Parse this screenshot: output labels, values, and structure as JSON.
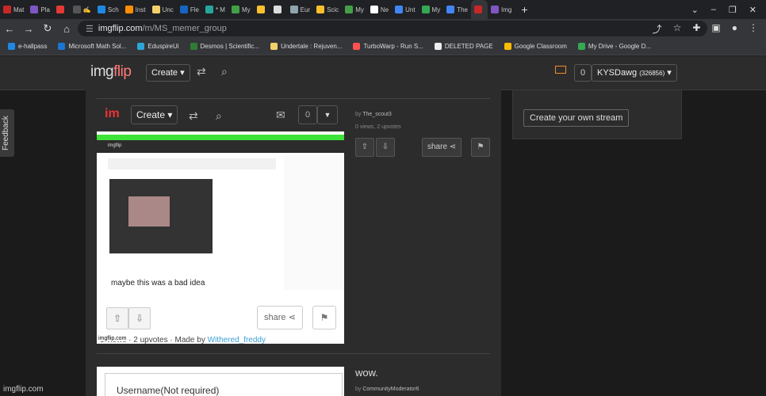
{
  "tabs": [
    {
      "label": "Mat",
      "color": "#c62828"
    },
    {
      "label": "Pla",
      "color": "#7e57c2"
    },
    {
      "label": "",
      "color": "#e53935"
    },
    {
      "label": "✍",
      "color": "#555555"
    },
    {
      "label": "Sch",
      "color": "#1e88e5"
    },
    {
      "label": "Inst",
      "color": "#ff8f00"
    },
    {
      "label": "Unc",
      "color": "#f2d16b"
    },
    {
      "label": "Fle",
      "color": "#1565c0"
    },
    {
      "label": "* M",
      "color": "#26a69a"
    },
    {
      "label": "My",
      "color": "#43a047"
    },
    {
      "label": "",
      "color": "#fbc02d"
    },
    {
      "label": "",
      "color": "#dddddd"
    },
    {
      "label": "Eur",
      "color": "#90a4ae"
    },
    {
      "label": "Scic",
      "color": "#fbc02d"
    },
    {
      "label": "My",
      "color": "#43a047"
    },
    {
      "label": "Ne",
      "color": "#ffffff"
    },
    {
      "label": "Unt",
      "color": "#4285f4"
    },
    {
      "label": "My",
      "color": "#34a853"
    },
    {
      "label": "The",
      "color": "#4285f4"
    },
    {
      "label": "",
      "color": "#c62828"
    },
    {
      "label": "Img",
      "color": "#7e57c2"
    }
  ],
  "url": {
    "host": "imgflip.com",
    "path": "/m/MS_memer_group"
  },
  "bookmarks": [
    {
      "label": "e-hallpass",
      "color": "#1e88e5"
    },
    {
      "label": "Microsoft Math Sol...",
      "color": "#1976d2"
    },
    {
      "label": "EduspireUi",
      "color": "#2aa7d8"
    },
    {
      "label": "Desmos | Scientific...",
      "color": "#2e7d32"
    },
    {
      "label": "Undertale : Rejuven...",
      "color": "#f2d16b"
    },
    {
      "label": "TurboWarp - Run S...",
      "color": "#ff5252"
    },
    {
      "label": "DELETED PAGE",
      "color": "#eeeeee"
    },
    {
      "label": "Google Classroom",
      "color": "#fbbc04"
    },
    {
      "label": "My Drive - Google D...",
      "color": "#34a853"
    }
  ],
  "site": {
    "logo_a": "img",
    "logo_b": "flip",
    "create_label": "Create",
    "notif_count": "0",
    "username": "KYSDawg",
    "user_points": "(326856)"
  },
  "sidebar": {
    "stream_button": "Create your own stream"
  },
  "post": {
    "inner_logo": "im",
    "inner_create": "Create",
    "inner_count": "0",
    "author_prefix": "by",
    "author": "The_scout3",
    "stats": "0 views, 2 upvotes",
    "share_label": "share",
    "caption": "maybe this was a bad idea",
    "meme_share": "share",
    "meme_footer": "3 views · 2 upvotes · Made by",
    "meme_footer_user": "Withered_freddy",
    "meme_watermark": "imgflip.com"
  },
  "next_post": {
    "title": "wow.",
    "author_prefix": "by",
    "author": "CommunityModerator6",
    "comment_placeholder": "Username(Not required)"
  },
  "feedback_label": "Feedback",
  "watermark": "imgflip.com"
}
